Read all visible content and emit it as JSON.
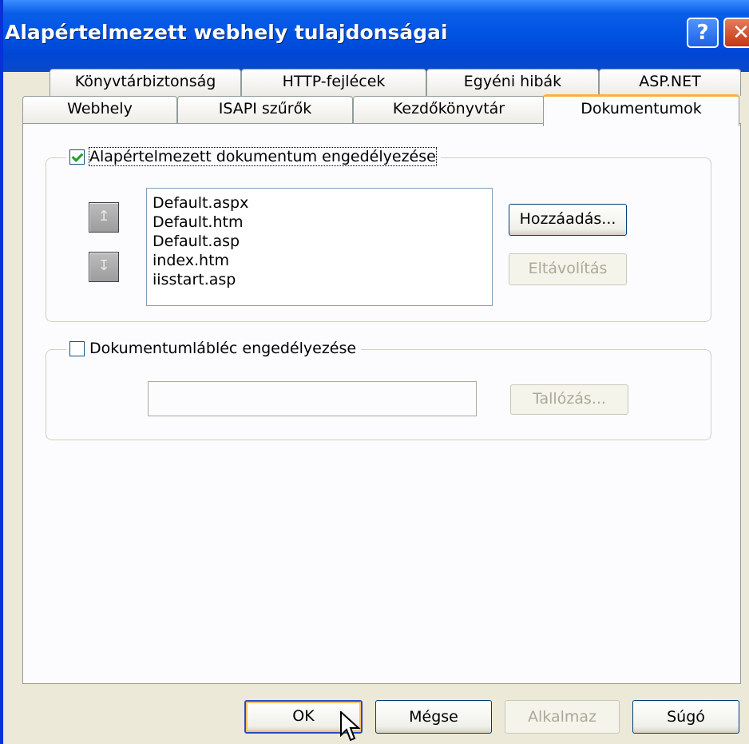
{
  "window": {
    "title": "Alapértelmezett webhely tulajdonságai"
  },
  "titlebar": {
    "help_label": "?",
    "close_label": "✕"
  },
  "tabs_row1": [
    {
      "label": "Könyvtárbiztonság"
    },
    {
      "label": "HTTP-fejlécek"
    },
    {
      "label": "Egyéni hibák"
    },
    {
      "label": "ASP.NET"
    }
  ],
  "tabs_row2": [
    {
      "label": "Webhely"
    },
    {
      "label": "ISAPI szűrők"
    },
    {
      "label": "Kezdőkönyvtár"
    },
    {
      "label": "Dokumentumok",
      "active": true
    }
  ],
  "default_doc": {
    "enable_label": "Alapértelmezett dokumentum engedélyezése",
    "checked": true,
    "items": [
      "Default.aspx",
      "Default.htm",
      "Default.asp",
      "index.htm",
      "iisstart.asp"
    ],
    "move_up_icon": "arrow-up-icon",
    "move_down_icon": "arrow-down-icon",
    "add_label": "Hozzáadás...",
    "remove_label": "Eltávolítás"
  },
  "footer_doc": {
    "enable_label": "Dokumentumlábléc engedélyezése",
    "checked": false,
    "path_value": "",
    "browse_label": "Tallózás..."
  },
  "buttons": {
    "ok": "OK",
    "cancel": "Mégse",
    "apply": "Alkalmaz",
    "help": "Súgó"
  }
}
